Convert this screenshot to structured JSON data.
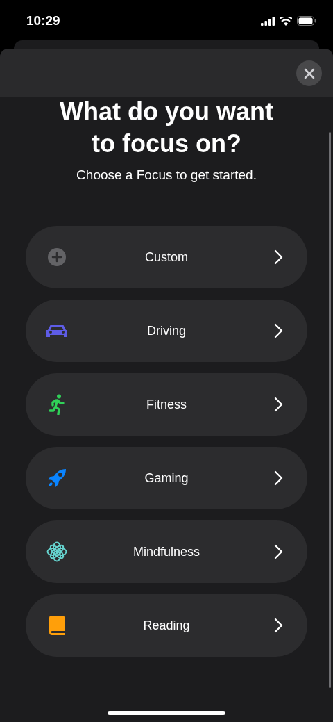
{
  "status_bar": {
    "time": "10:29"
  },
  "sheet": {
    "title_cut_line": "What do you want",
    "title": "to focus on?",
    "subtitle": "Choose a Focus to get started."
  },
  "focuses": [
    {
      "kind": "custom",
      "label": "Custom",
      "color": "#636366"
    },
    {
      "kind": "driving",
      "label": "Driving",
      "color": "#5e5ce6"
    },
    {
      "kind": "fitness",
      "label": "Fitness",
      "color": "#30d158"
    },
    {
      "kind": "gaming",
      "label": "Gaming",
      "color": "#0a84ff"
    },
    {
      "kind": "mindfulness",
      "label": "Mindfulness",
      "color": "#66d4cf"
    },
    {
      "kind": "reading",
      "label": "Reading",
      "color": "#ff9f0a"
    }
  ]
}
